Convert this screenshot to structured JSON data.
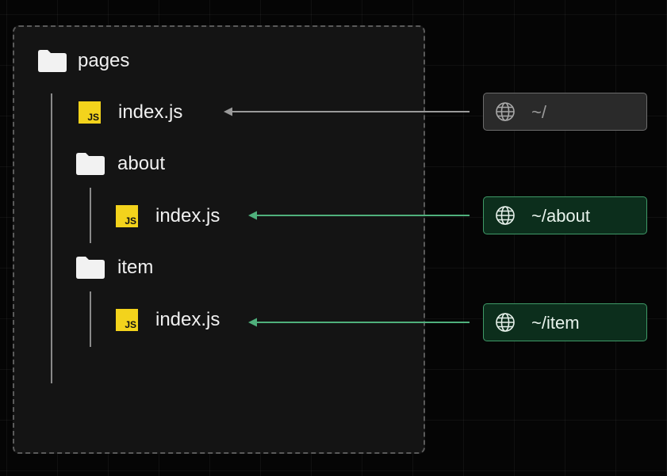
{
  "tree": {
    "root": {
      "label": "pages",
      "icon": "folder-icon"
    },
    "items": [
      {
        "label": "index.js",
        "icon": "js-file-icon",
        "icon_text": "JS"
      },
      {
        "label": "about",
        "icon": "folder-icon"
      },
      {
        "label": "index.js",
        "icon": "js-file-icon",
        "icon_text": "JS"
      },
      {
        "label": "item",
        "icon": "folder-icon"
      },
      {
        "label": "index.js",
        "icon": "js-file-icon",
        "icon_text": "JS"
      }
    ]
  },
  "routes": [
    {
      "path": "~/",
      "icon": "globe-icon",
      "state": "neutral"
    },
    {
      "path": "~/about",
      "icon": "globe-icon",
      "state": "active"
    },
    {
      "path": "~/item",
      "icon": "globe-icon",
      "state": "active"
    }
  ],
  "colors": {
    "neutral_arrow": "#9a9a9a",
    "active_arrow": "#4fb07c",
    "js_badge": "#f3d31c",
    "active_route_bg": "#0c2e1c",
    "active_route_border": "#3f9a68"
  }
}
